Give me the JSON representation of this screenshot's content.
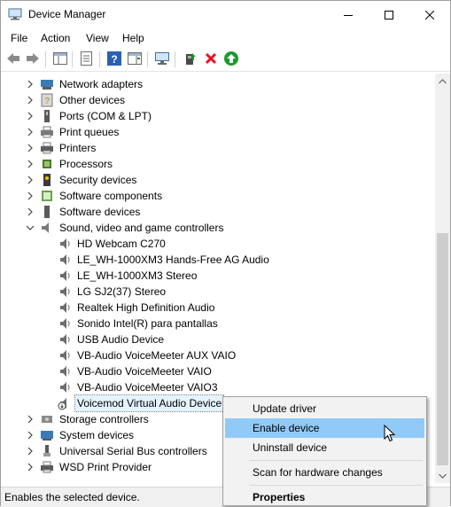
{
  "window": {
    "title": "Device Manager"
  },
  "menu": {
    "items": [
      "File",
      "Action",
      "View",
      "Help"
    ]
  },
  "toolbar": {
    "buttons": [
      "back-icon",
      "forward-icon",
      "show-hide-console-tree-icon",
      "properties-icon",
      "help-icon",
      "action-pane-icon",
      "scan-hardware-icon",
      "update-driver-icon",
      "uninstall-icon",
      "enable-icon"
    ]
  },
  "tree": {
    "categories_top": [
      "Network adapters",
      "Other devices",
      "Ports (COM & LPT)",
      "Print queues",
      "Printers",
      "Processors",
      "Security devices",
      "Software components",
      "Software devices",
      "Sound, video and game controllers"
    ],
    "sound_children": [
      "HD Webcam C270",
      "LE_WH-1000XM3 Hands-Free AG Audio",
      "LE_WH-1000XM3 Stereo",
      "LG SJ2(37) Stereo",
      "Realtek High Definition Audio",
      "Sonido Intel(R) para pantallas",
      "USB Audio Device",
      "VB-Audio VoiceMeeter AUX VAIO",
      "VB-Audio VoiceMeeter VAIO",
      "VB-Audio VoiceMeeter VAIO3",
      "Voicemod Virtual Audio Device"
    ],
    "categories_bottom": [
      "Storage controllers",
      "System devices",
      "Universal Serial Bus controllers",
      "WSD Print Provider"
    ]
  },
  "context_menu": {
    "update_driver": "Update driver",
    "enable_device": "Enable device",
    "uninstall_device": "Uninstall device",
    "scan": "Scan for hardware changes",
    "properties": "Properties"
  },
  "status": {
    "text": "Enables the selected device."
  },
  "colors": {
    "highlight": "#91c9f7",
    "selection": "#e5f3ff",
    "enable_green": "#1a9a2e",
    "uninstall_red": "#e81123"
  }
}
